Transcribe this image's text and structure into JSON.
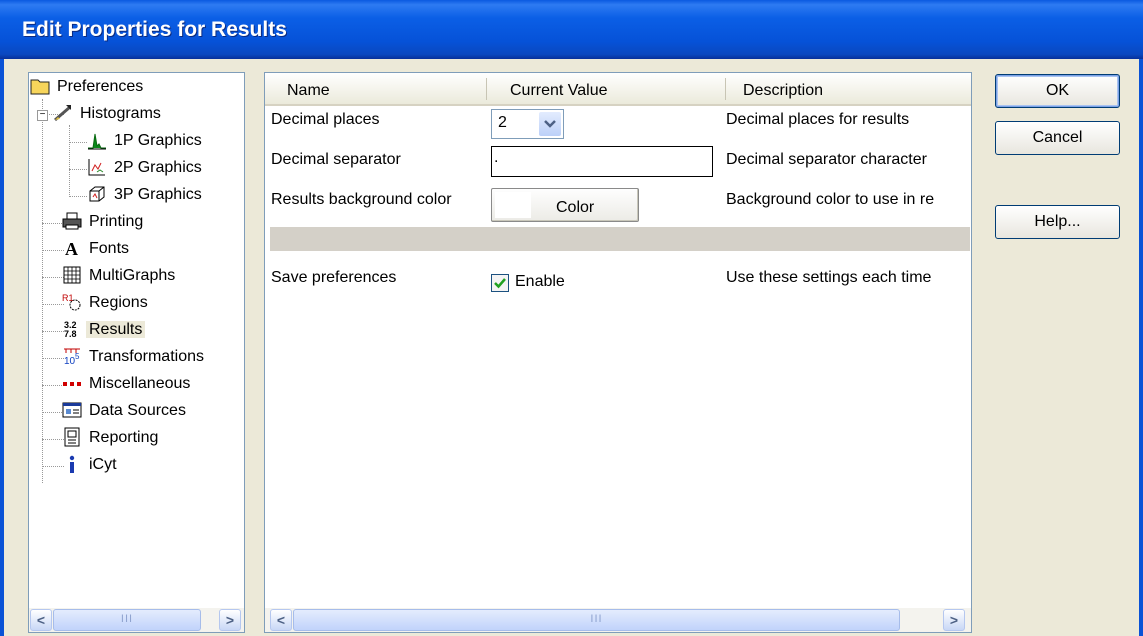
{
  "window": {
    "title": "Edit Properties for Results"
  },
  "tree": {
    "items": [
      {
        "label": "Preferences",
        "icon": "folder-icon"
      },
      {
        "label": "Histograms",
        "icon": "histogram-icon"
      },
      {
        "label": "1P Graphics",
        "icon": "1p-graphics-icon"
      },
      {
        "label": "2P Graphics",
        "icon": "2p-graphics-icon"
      },
      {
        "label": "3P Graphics",
        "icon": "3p-graphics-icon"
      },
      {
        "label": "Printing",
        "icon": "printer-icon"
      },
      {
        "label": "Fonts",
        "icon": "font-icon"
      },
      {
        "label": "MultiGraphs",
        "icon": "multigraph-icon"
      },
      {
        "label": "Regions",
        "icon": "regions-icon"
      },
      {
        "label": "Results",
        "icon": "results-icon"
      },
      {
        "label": "Transformations",
        "icon": "transformations-icon"
      },
      {
        "label": "Miscellaneous",
        "icon": "miscellaneous-icon"
      },
      {
        "label": "Data Sources",
        "icon": "data-sources-icon"
      },
      {
        "label": "Reporting",
        "icon": "reporting-icon"
      },
      {
        "label": "iCyt",
        "icon": "info-icon"
      }
    ],
    "selected": "Results",
    "scroll_thumb": "III"
  },
  "grid": {
    "headers": {
      "name": "Name",
      "value": "Current Value",
      "description": "Description"
    },
    "rows": [
      {
        "name": "Decimal places",
        "value": "2",
        "description": "Decimal places for results"
      },
      {
        "name": "Decimal separator",
        "value": ".",
        "description": "Decimal separator character"
      },
      {
        "name": "Results background color",
        "value": "Color",
        "description": "Background color to use in re"
      },
      {
        "name": "Save preferences",
        "value": "Enable",
        "description": "Use these settings each time"
      }
    ],
    "save_enabled": true,
    "scroll_thumb": "III"
  },
  "buttons": {
    "ok": "OK",
    "cancel": "Cancel",
    "help": "Help..."
  },
  "colors": {
    "titlebar": "#0A52D6",
    "dialog_bg": "#ECE9D8",
    "selection": "#ECE9D8"
  }
}
